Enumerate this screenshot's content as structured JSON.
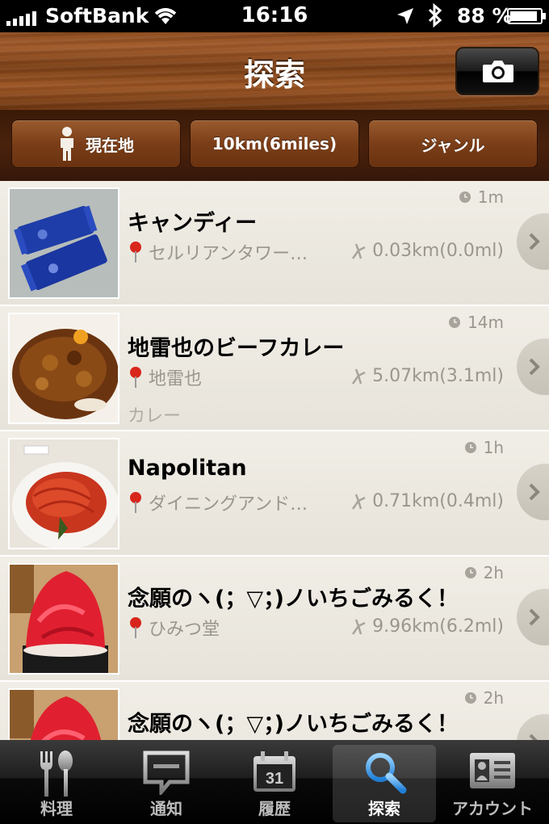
{
  "status_bar": {
    "carrier": "SoftBank",
    "time": "16:16",
    "battery": "88 %"
  },
  "nav": {
    "title": "探索",
    "camera_icon": "camera-icon"
  },
  "filters": {
    "location": "現在地",
    "distance": "10km(6miles)",
    "genre": "ジャンル"
  },
  "items": [
    {
      "title": "キャンディー",
      "place": "セルリアンタワー…",
      "distance": "0.03km(0.0ml)",
      "time": "1m",
      "genre": ""
    },
    {
      "title": "地雷也のビーフカレー",
      "place": "地雷也",
      "distance": "5.07km(3.1ml)",
      "time": "14m",
      "genre": "カレー"
    },
    {
      "title": "Napolitan",
      "place": "ダイニングアンド…",
      "distance": "0.71km(0.4ml)",
      "time": "1h",
      "genre": ""
    },
    {
      "title": "念願のヽ(；▽；)ノいちごみるく！",
      "place": "ひみつ堂",
      "distance": "9.96km(6.2ml)",
      "time": "2h",
      "genre": ""
    },
    {
      "title": "念願のヽ(；▽；)ノいちごみるく！",
      "place": "",
      "distance": "",
      "time": "2h",
      "genre": ""
    }
  ],
  "tabs": [
    {
      "label": "料理",
      "icon": "fork-spoon-icon"
    },
    {
      "label": "通知",
      "icon": "speech-bubble-icon"
    },
    {
      "label": "履歴",
      "icon": "calendar-icon",
      "calendar_day": "31"
    },
    {
      "label": "探索",
      "icon": "search-icon",
      "active": true
    },
    {
      "label": "アカウント",
      "icon": "id-card-icon"
    }
  ],
  "colors": {
    "wood": "#8a4a1e",
    "active_tab_icon": "#3aa0e8",
    "meta_text": "#9a968e"
  }
}
